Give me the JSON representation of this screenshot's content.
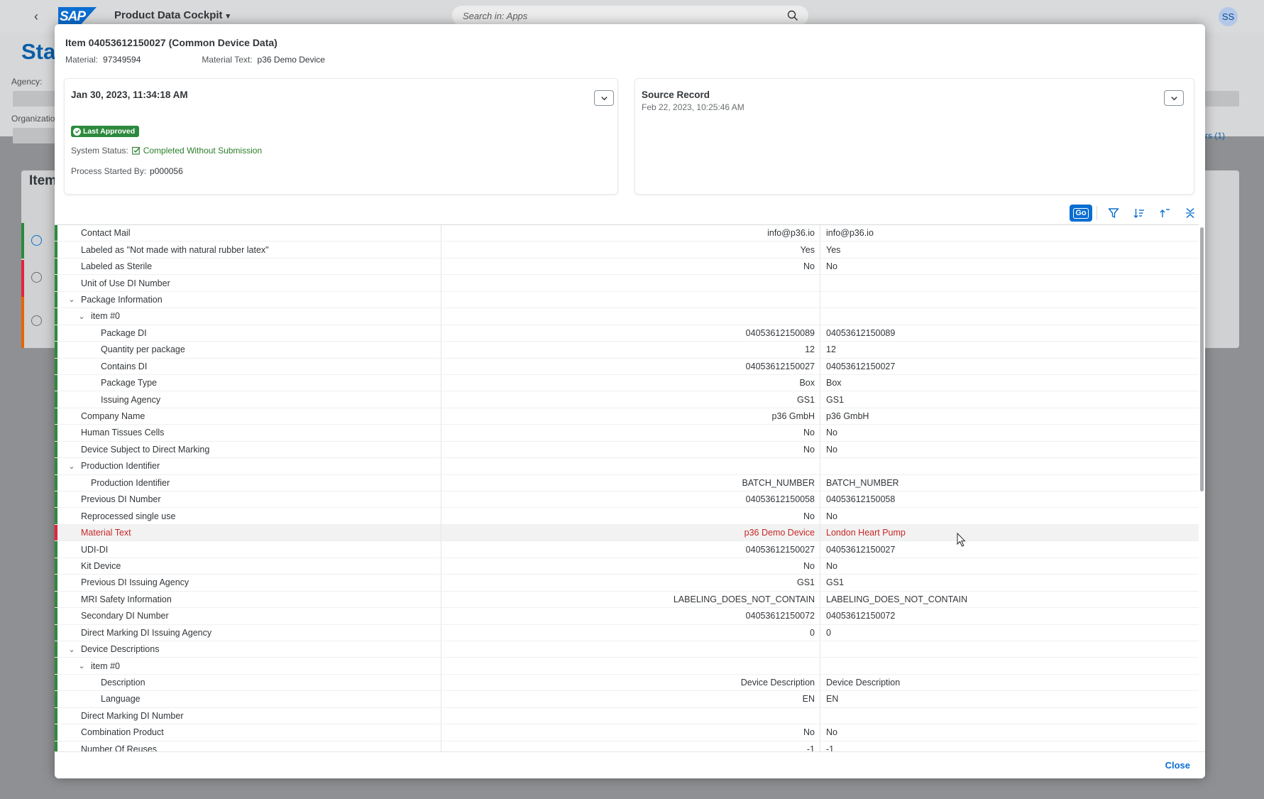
{
  "shell": {
    "logo": "SAP",
    "app_title": "Product Data Cockpit",
    "search_placeholder": "Search in: Apps",
    "avatar_initials": "SS"
  },
  "background": {
    "page_title": "Sta",
    "agency_label": "Agency:",
    "org_label": "Organizatio",
    "filters_link": "ters (1)",
    "items_title": "Item"
  },
  "dialog": {
    "title": "Item 04053612150027 (Common Device Data)",
    "material_label": "Material:",
    "material_value": "97349594",
    "material_text_label": "Material Text:",
    "material_text_value": "p36 Demo Device",
    "left_panel": {
      "timestamp": "Jan 30, 2023, 11:34:18 AM",
      "badge": "Last Approved",
      "system_status_label": "System Status:",
      "system_status_value": "Completed Without Submission",
      "process_started_label": "Process Started By:",
      "process_started_value": "p000056"
    },
    "right_panel": {
      "title": "Source Record",
      "timestamp": "Feb 22, 2023, 10:25:46 AM"
    },
    "toolbar": {
      "go_label": "Go"
    },
    "close_label": "Close",
    "colors": {
      "accent": "#0a6ed1",
      "success": "#2c8a3e",
      "error": "#e6233c"
    }
  },
  "rows": [
    {
      "label": "Contact Mail",
      "level": 0,
      "toggle": "",
      "a": "info@p36.io",
      "b": "info@p36.io",
      "status": "ok"
    },
    {
      "label": "Labeled as \"Not made with natural rubber latex\"",
      "level": 0,
      "toggle": "",
      "a": "Yes",
      "b": "Yes",
      "status": "ok"
    },
    {
      "label": "Labeled as Sterile",
      "level": 0,
      "toggle": "",
      "a": "No",
      "b": "No",
      "status": "ok"
    },
    {
      "label": "Unit of Use DI Number",
      "level": 0,
      "toggle": "",
      "a": "",
      "b": "",
      "status": "ok"
    },
    {
      "label": "Package Information",
      "level": 0,
      "toggle": "⌄",
      "a": "",
      "b": "",
      "status": "ok"
    },
    {
      "label": "item #0",
      "level": 1,
      "toggle": "⌄",
      "a": "",
      "b": "",
      "status": "ok"
    },
    {
      "label": "Package DI",
      "level": 2,
      "toggle": "",
      "a": "04053612150089",
      "b": "04053612150089",
      "status": "ok"
    },
    {
      "label": "Quantity per package",
      "level": 2,
      "toggle": "",
      "a": "12",
      "b": "12",
      "status": "ok"
    },
    {
      "label": "Contains DI",
      "level": 2,
      "toggle": "",
      "a": "04053612150027",
      "b": "04053612150027",
      "status": "ok"
    },
    {
      "label": "Package Type",
      "level": 2,
      "toggle": "",
      "a": "Box",
      "b": "Box",
      "status": "ok"
    },
    {
      "label": "Issuing Agency",
      "level": 2,
      "toggle": "",
      "a": "GS1",
      "b": "GS1",
      "status": "ok"
    },
    {
      "label": "Company Name",
      "level": 0,
      "toggle": "",
      "a": "p36 GmbH",
      "b": "p36 GmbH",
      "status": "ok"
    },
    {
      "label": "Human Tissues Cells",
      "level": 0,
      "toggle": "",
      "a": "No",
      "b": "No",
      "status": "ok"
    },
    {
      "label": "Device Subject to Direct Marking",
      "level": 0,
      "toggle": "",
      "a": "No",
      "b": "No",
      "status": "ok"
    },
    {
      "label": "Production Identifier",
      "level": 0,
      "toggle": "⌄",
      "a": "",
      "b": "",
      "status": "ok"
    },
    {
      "label": "Production Identifier",
      "level": 1,
      "toggle": "",
      "a": "BATCH_NUMBER",
      "b": "BATCH_NUMBER",
      "status": "ok"
    },
    {
      "label": "Previous DI Number",
      "level": 0,
      "toggle": "",
      "a": "04053612150058",
      "b": "04053612150058",
      "status": "ok"
    },
    {
      "label": "Reprocessed single use",
      "level": 0,
      "toggle": "",
      "a": "No",
      "b": "No",
      "status": "ok"
    },
    {
      "label": "Material Text",
      "level": 0,
      "toggle": "",
      "a": "p36 Demo Device",
      "b": "London Heart Pump",
      "status": "error"
    },
    {
      "label": "UDI-DI",
      "level": 0,
      "toggle": "",
      "a": "04053612150027",
      "b": "04053612150027",
      "status": "ok"
    },
    {
      "label": "Kit Device",
      "level": 0,
      "toggle": "",
      "a": "No",
      "b": "No",
      "status": "ok"
    },
    {
      "label": "Previous DI Issuing Agency",
      "level": 0,
      "toggle": "",
      "a": "GS1",
      "b": "GS1",
      "status": "ok"
    },
    {
      "label": "MRI Safety Information",
      "level": 0,
      "toggle": "",
      "a": "LABELING_DOES_NOT_CONTAIN",
      "b": "LABELING_DOES_NOT_CONTAIN",
      "status": "ok"
    },
    {
      "label": "Secondary DI Number",
      "level": 0,
      "toggle": "",
      "a": "04053612150072",
      "b": "04053612150072",
      "status": "ok"
    },
    {
      "label": "Direct Marking DI Issuing Agency",
      "level": 0,
      "toggle": "",
      "a": "0",
      "b": "0",
      "status": "ok"
    },
    {
      "label": "Device Descriptions",
      "level": 0,
      "toggle": "⌄",
      "a": "",
      "b": "",
      "status": "ok"
    },
    {
      "label": "item #0",
      "level": 1,
      "toggle": "⌄",
      "a": "",
      "b": "",
      "status": "ok"
    },
    {
      "label": "Description",
      "level": 2,
      "toggle": "",
      "a": "Device Description",
      "b": "Device Description",
      "status": "ok"
    },
    {
      "label": "Language",
      "level": 2,
      "toggle": "",
      "a": "EN",
      "b": "EN",
      "status": "ok"
    },
    {
      "label": "Direct Marking DI Number",
      "level": 0,
      "toggle": "",
      "a": "",
      "b": "",
      "status": "ok"
    },
    {
      "label": "Combination Product",
      "level": 0,
      "toggle": "",
      "a": "No",
      "b": "No",
      "status": "ok"
    },
    {
      "label": "Number Of Reuses",
      "level": 0,
      "toggle": "",
      "a": "-1",
      "b": "-1",
      "status": "ok"
    }
  ]
}
